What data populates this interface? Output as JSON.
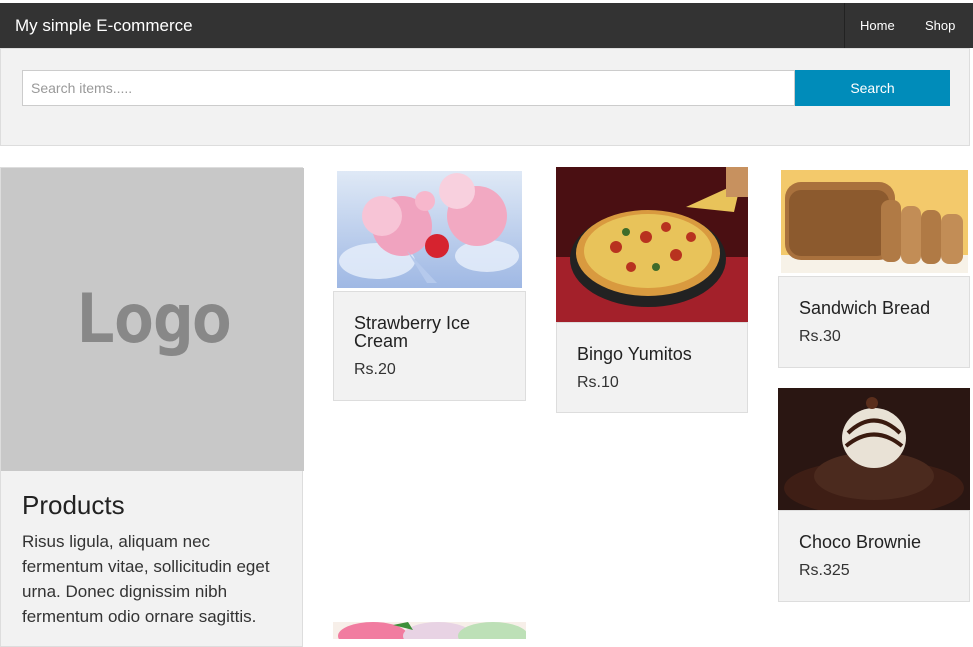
{
  "header": {
    "brand": "My simple E-commerce",
    "nav": [
      {
        "label": "Home"
      },
      {
        "label": "Shop"
      }
    ]
  },
  "search": {
    "placeholder": "Search items.....",
    "value": "",
    "button_label": "Search"
  },
  "sidebar": {
    "logo_text": "Logo",
    "title": "Products",
    "description": "Risus ligula, aliquam nec fermentum vitae, sollicitudin eget urna. Donec dignissim nibh fermentum odio ornare sagittis."
  },
  "products": [
    {
      "name": "Strawberry Ice Cream",
      "price": "Rs.20",
      "image": "strawberry-ice-cream-image"
    },
    {
      "name": "Bingo Yumitos",
      "price": "Rs.10",
      "image": "pizza-image"
    },
    {
      "name": "Sandwich Bread",
      "price": "Rs.30",
      "image": "bread-image"
    },
    {
      "name": "Choco Brownie",
      "price": "Rs.325",
      "image": "brownie-image"
    }
  ],
  "colors": {
    "navbar_bg": "#333333",
    "search_button": "#008cba",
    "panel_bg": "#f2f2f2",
    "logo_bg": "#c8c8c8"
  }
}
